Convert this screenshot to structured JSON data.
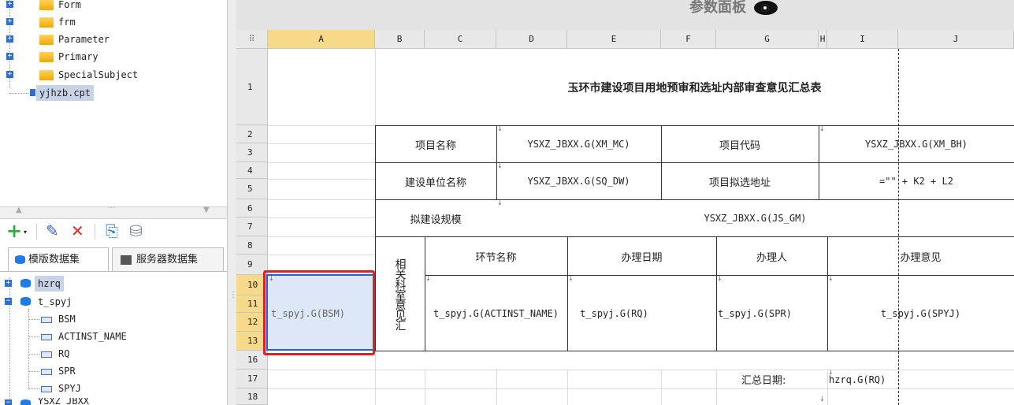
{
  "tree": {
    "folders": [
      "Form",
      "frm",
      "Parameter",
      "Primary",
      "SpecialSubject"
    ],
    "file": "yjhzb.cpt"
  },
  "toolbar": {
    "add": "+",
    "edit": "✎",
    "delete": "✕",
    "preview": "⎘",
    "server": "⛁",
    "resize": "···"
  },
  "tabs": {
    "template_ds": "模版数据集",
    "server_ds": "服务器数据集"
  },
  "datasets": {
    "items": [
      {
        "name": "hzrq"
      },
      {
        "name": "t_spyj",
        "fields": [
          "BSM",
          "ACTINST_NAME",
          "RQ",
          "SPR",
          "SPYJ"
        ]
      },
      {
        "name": "YSXZ_JBXX"
      }
    ]
  },
  "panel_title": "参数面板",
  "grid": {
    "columns": [
      "A",
      "B",
      "C",
      "D",
      "E",
      "F",
      "G",
      "H",
      "I",
      "J"
    ],
    "corner": "⠿",
    "rows": [
      "1",
      "2",
      "3",
      "4",
      "5",
      "6",
      "7",
      "8",
      "9",
      "10",
      "11",
      "12",
      "13",
      "16",
      "17",
      "18"
    ],
    "cells": {
      "title": "玉环市建设项目用地预审和选址内部审查意见汇总表",
      "xm_mc_label": "项目名称",
      "xm_mc": "YSXZ_JBXX.G(XM_MC)",
      "xm_bh_label": "项目代码",
      "xm_bh": "YSXZ_JBXX.G(XM_BH)",
      "sq_dw_label": "建设单位名称",
      "sq_dw": "YSXZ_JBXX.G(SQ_DW)",
      "addr_label": "项目拟选地址",
      "addr": "=\"\" + K2 + L2",
      "gm_label": "拟建设规模",
      "gm": "YSXZ_JBXX.G(JS_GM)",
      "vertical_label": "相关科室意见汇",
      "h_node": "环节名称",
      "h_date": "办理日期",
      "h_person": "办理人",
      "h_opinion": "办理意见",
      "bsm": "t_spyj.G(BSM)",
      "actinst": "t_spyj.G(ACTINST_NAME)",
      "rq": "t_spyj.G(RQ)",
      "spr": "t_spyj.G(SPR)",
      "spyj": "t_spyj.G(SPYJ)",
      "sum_date_label": "汇总日期:",
      "sum_date": "hzrq.G(RQ)"
    }
  },
  "colors": {
    "selection": "#1f5fe0",
    "selection_outer": "#e02020",
    "header_selected": "#f7d98a"
  }
}
